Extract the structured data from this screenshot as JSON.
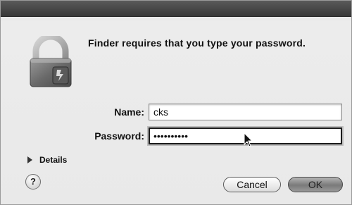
{
  "dialog": {
    "prompt": "Finder requires that you type your password."
  },
  "form": {
    "name_label": "Name:",
    "name_value": "cks",
    "password_label": "Password:",
    "password_value": "••••••••••"
  },
  "details": {
    "label": "Details"
  },
  "help": {
    "label": "?"
  },
  "buttons": {
    "cancel": "Cancel",
    "ok": "OK"
  }
}
